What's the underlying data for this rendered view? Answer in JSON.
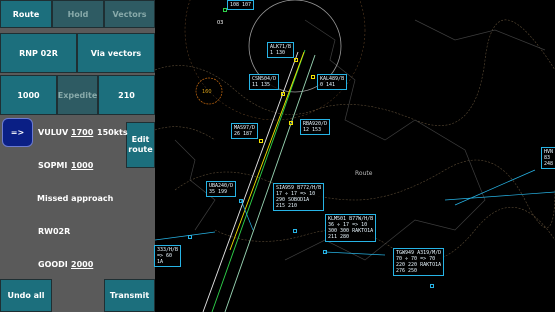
{
  "panel": {
    "tabs": [
      {
        "label": "Route"
      },
      {
        "label": "Hold"
      },
      {
        "label": "Vectors"
      }
    ],
    "runway_button": "RNP 02R",
    "vectors_button": "Via vectors",
    "speed_options": [
      "1000",
      "Expedite",
      "210"
    ],
    "arrow_button": "=>",
    "edit_route_button": "Edit\nroute",
    "waypoints": [
      {
        "name": "VULUV",
        "alt": "1700",
        "speed": "150kts"
      },
      {
        "name": "SOPMI",
        "alt": "1000"
      },
      {
        "name": "Missed approach"
      },
      {
        "name": "RW02R"
      },
      {
        "name": "GOODI",
        "alt": "2000"
      }
    ],
    "undo_button": "Undo all",
    "transmit_button": "Transmit"
  },
  "radar": {
    "labels": {
      "route": "Route",
      "num03": "03",
      "num160": "160"
    },
    "tags": [
      {
        "id": "top",
        "lines": "108 107"
      },
      {
        "id": "alk",
        "lines": "ALK71/B\n1 130"
      },
      {
        "id": "csn",
        "lines": "CSN504/D\n11 135"
      },
      {
        "id": "kal",
        "lines": "KAL489/B\n0 141"
      },
      {
        "id": "mas",
        "lines": "MAS97/D\n26 187"
      },
      {
        "id": "rba",
        "lines": "RBA920/D\n12 153"
      },
      {
        "id": "uba",
        "lines": "UBA240/D\n35 199"
      },
      {
        "id": "sia",
        "lines": "SIA959 B772/H/B\n17 ÷ 17 => 10\n290 SOBOD1A\n215 210"
      },
      {
        "id": "klm",
        "lines": "KLM501 B77W/H/B\n36 ÷ 17 => 10\n300 300 RAKTO1A\n211 280"
      },
      {
        "id": "tgw",
        "lines": "TGW949 A319/M/D\n70 ÷ 70 => 70\n220 220 RAKTO1A\n276 250"
      },
      {
        "id": "left",
        "lines": "333/H/B\n=> 60\n1A"
      },
      {
        "id": "right",
        "lines": "HVN\n83\n248"
      }
    ]
  }
}
